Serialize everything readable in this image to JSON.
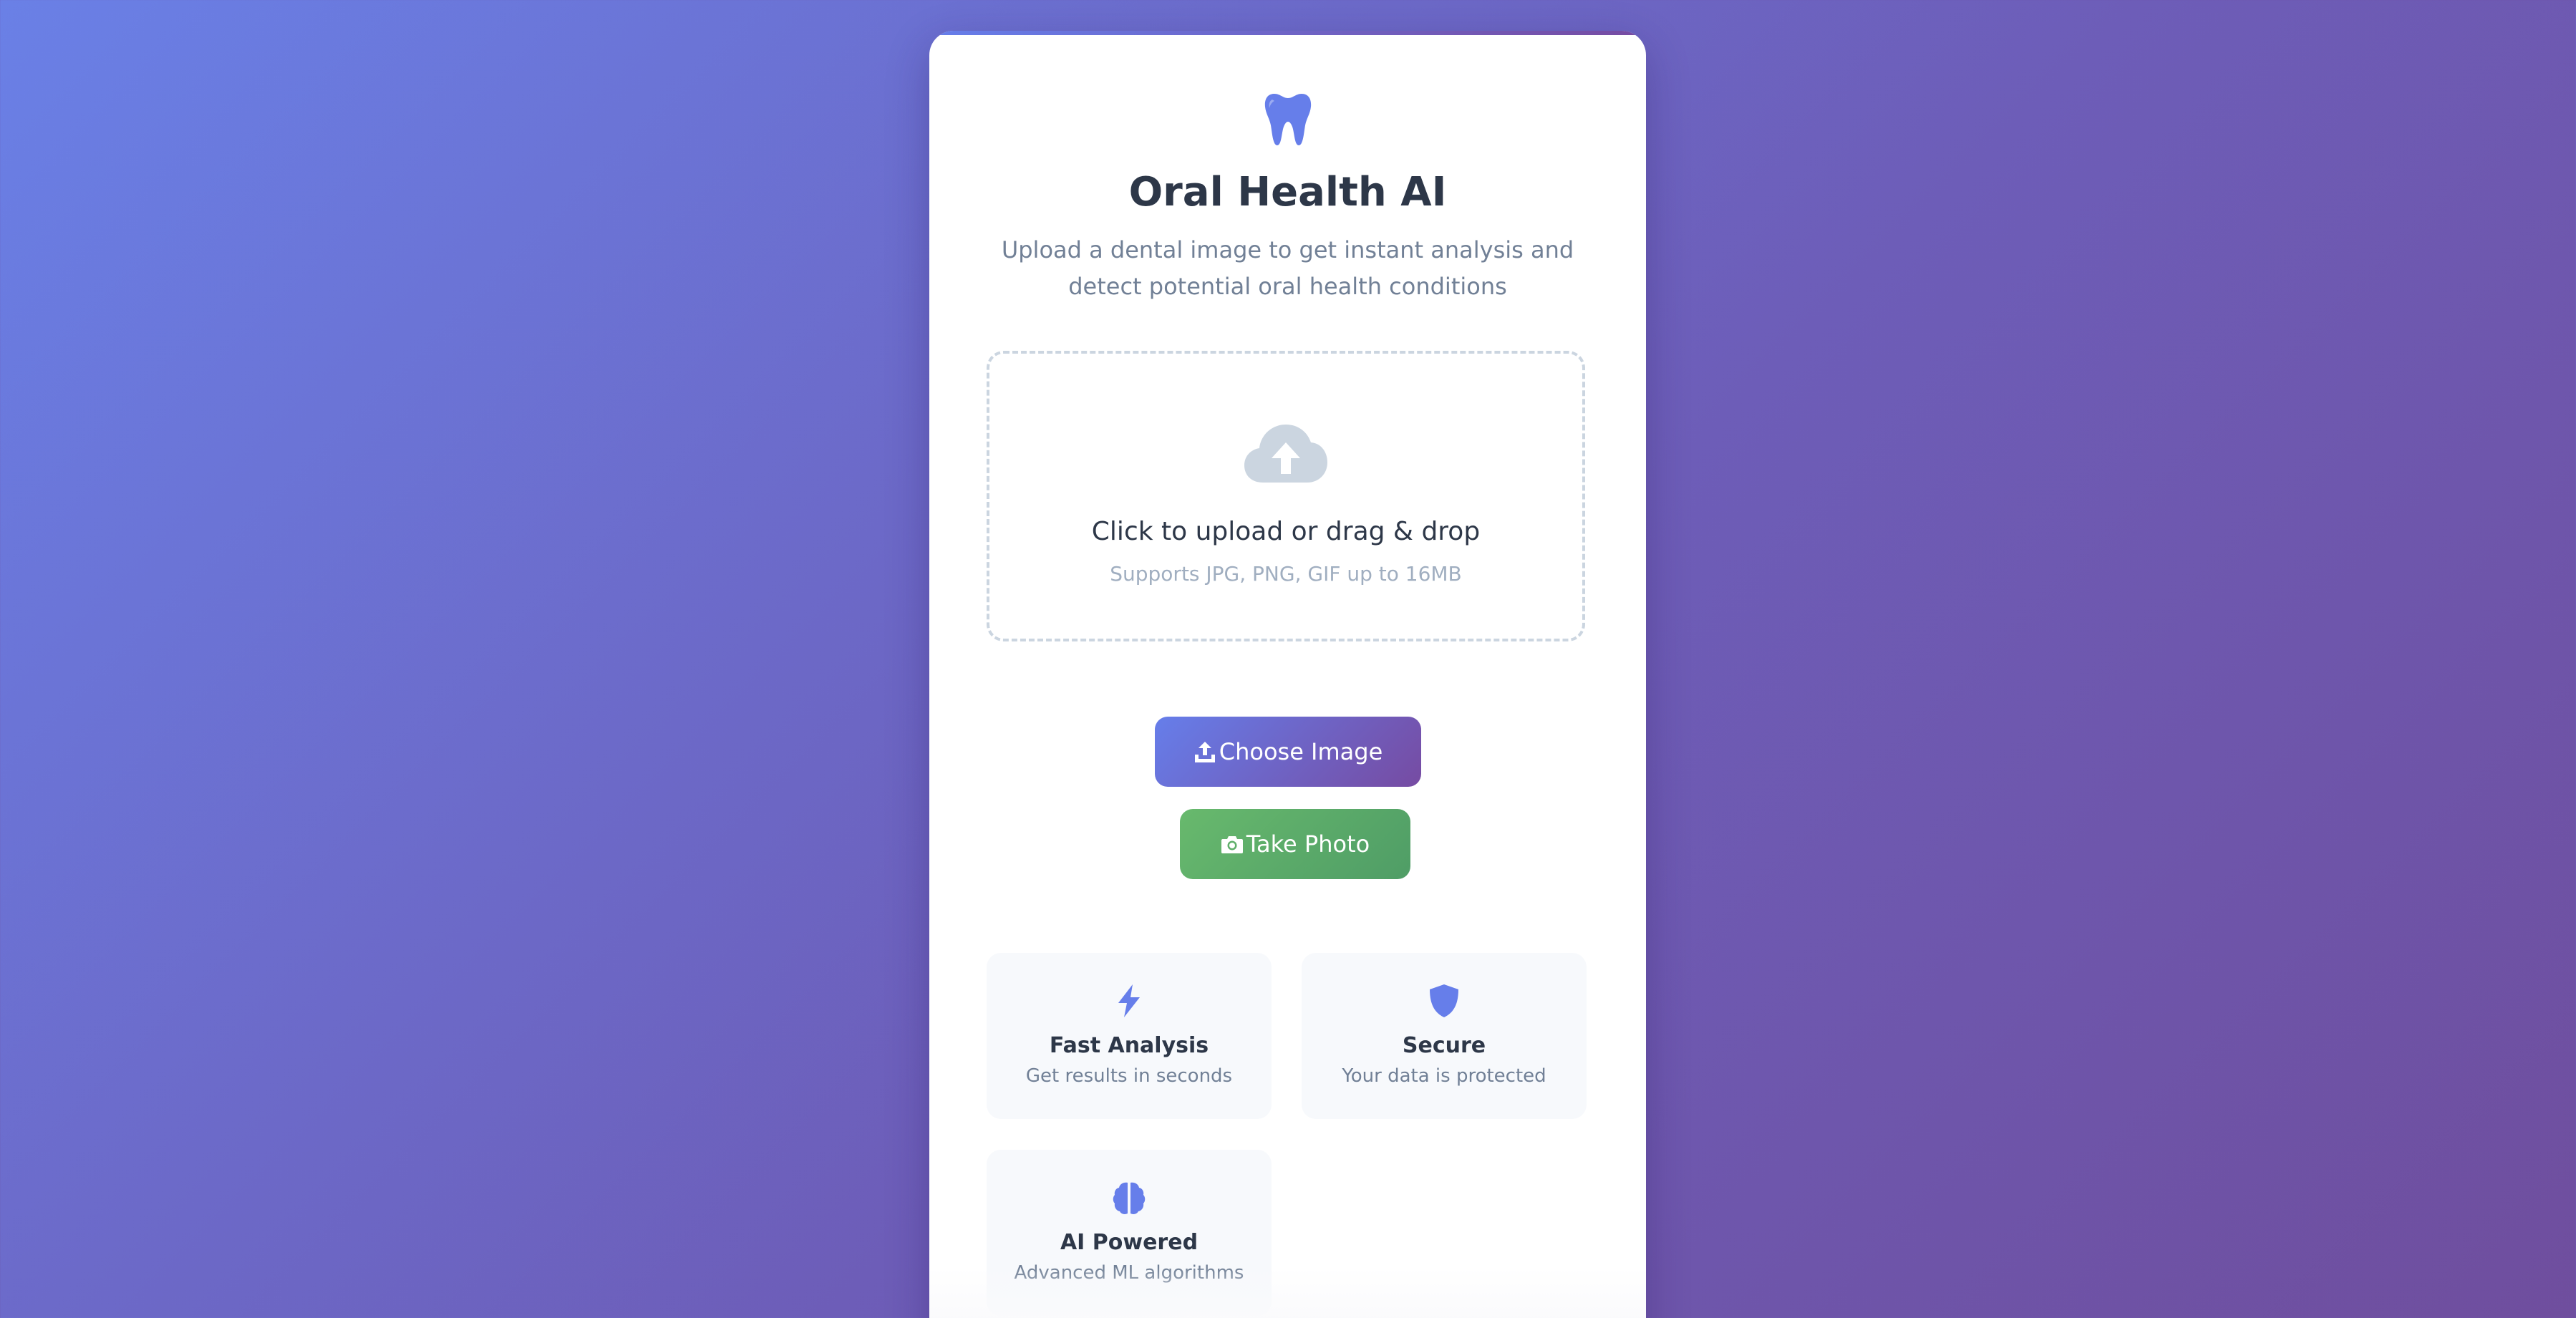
{
  "app": {
    "title": "Oral Health AI",
    "subtitle": "Upload a dental image to get instant analysis and detect potential oral health conditions",
    "icon": "tooth-icon",
    "accent_color": "#667eea",
    "accent_color_2": "#764ba2"
  },
  "upload": {
    "icon": "cloud-upload-icon",
    "main_text": "Click to upload or drag & drop",
    "sub_text": "Supports JPG, PNG, GIF up to 16MB"
  },
  "buttons": {
    "choose_image": {
      "label": "Choose Image",
      "icon": "upload-icon"
    },
    "take_photo": {
      "label": "Take Photo",
      "icon": "camera-icon",
      "color": "#5faf6a"
    }
  },
  "features": [
    {
      "icon": "bolt-icon",
      "title": "Fast Analysis",
      "description": "Get results in seconds"
    },
    {
      "icon": "shield-icon",
      "title": "Secure",
      "description": "Your data is protected"
    },
    {
      "icon": "brain-icon",
      "title": "AI Powered",
      "description": "Advanced ML algorithms"
    }
  ]
}
